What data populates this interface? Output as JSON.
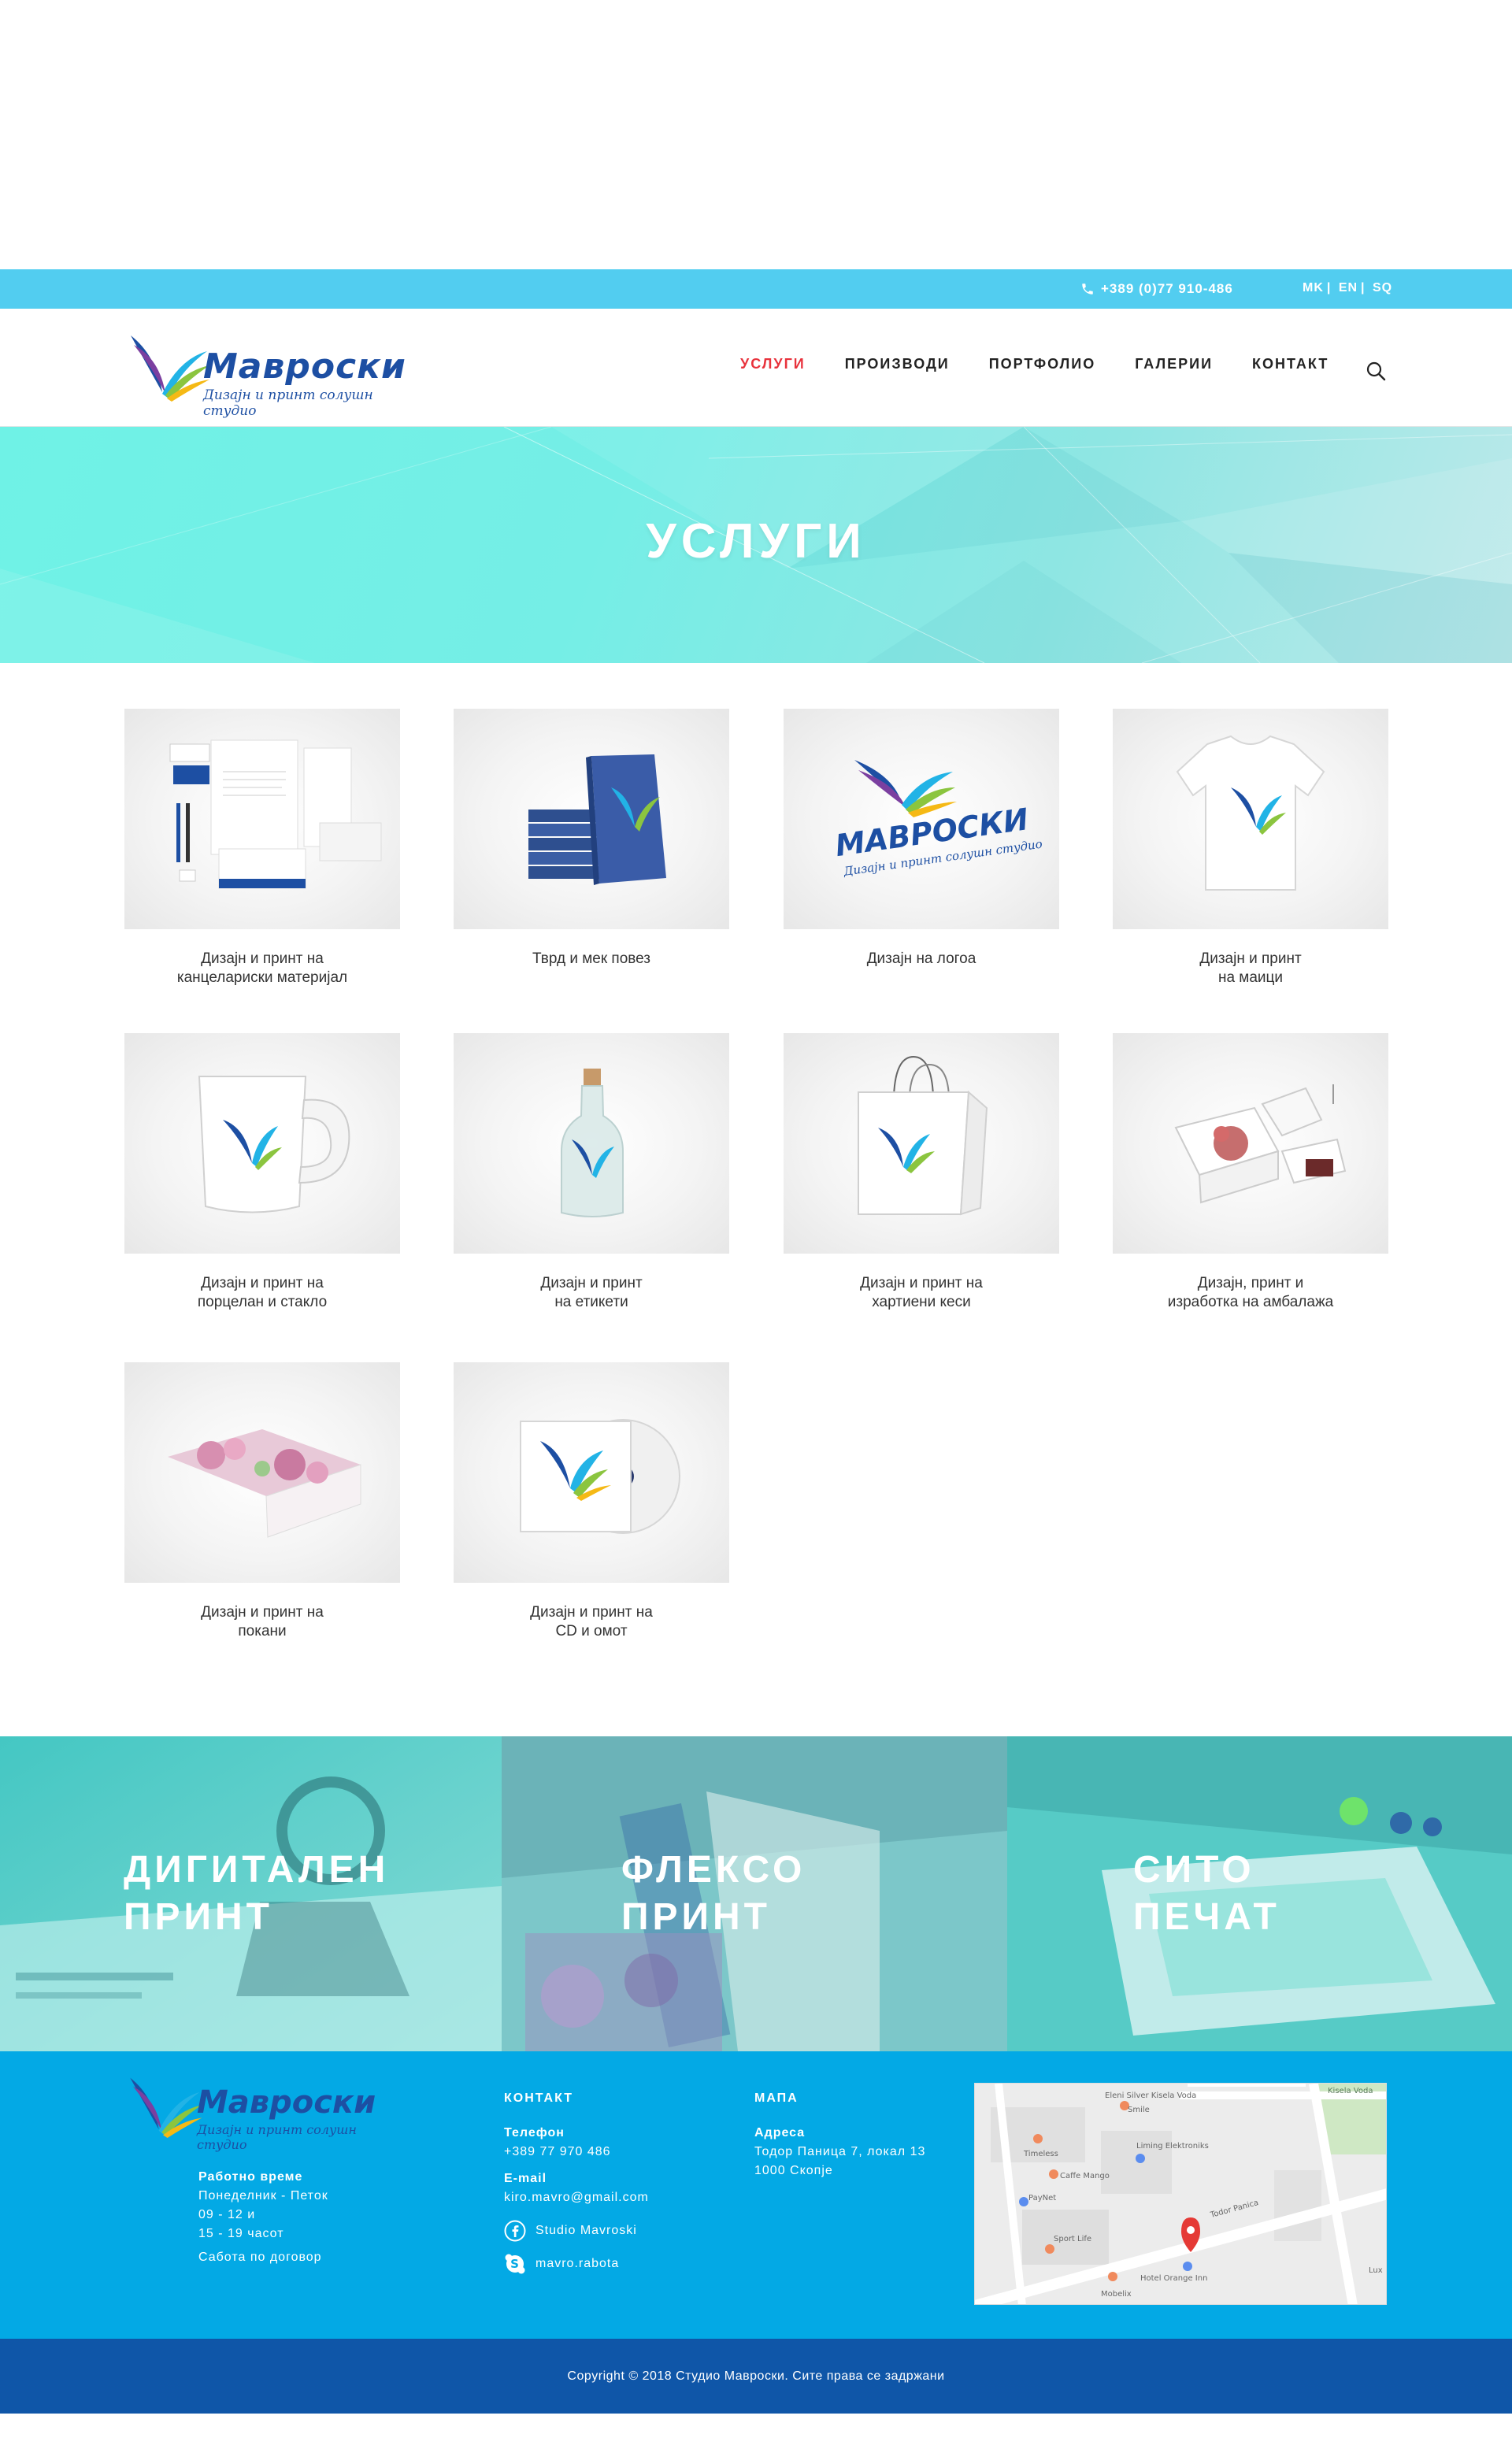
{
  "topbar": {
    "phone": "+389 (0)77 910-486",
    "languages": [
      "MK",
      "EN",
      "SQ"
    ]
  },
  "header": {
    "logo_text": "Мавроски",
    "logo_tagline": "Дизајн и принт солушн студио",
    "nav": [
      "УСЛУГИ",
      "ПРОИЗВОДИ",
      "ПОРТФОЛИО",
      "ГАЛЕРИИ",
      "КОНТАКТ"
    ],
    "active_nav": "УСЛУГИ"
  },
  "hero": {
    "title": "УСЛУГИ"
  },
  "services": [
    {
      "caption": "Дизајн и принт на\nканцелариски материјал",
      "icon": "stationery-icon"
    },
    {
      "caption": "Тврд и мек повез",
      "icon": "book-icon"
    },
    {
      "caption": "Дизајн на логоа",
      "icon": "logo-icon"
    },
    {
      "caption": "Дизајн и принт\nна маици",
      "icon": "tshirt-icon"
    },
    {
      "caption": "Дизајн и принт на\nпорцелан и стакло",
      "icon": "mug-icon"
    },
    {
      "caption": "Дизајн и принт\nна етикети",
      "icon": "bottle-icon"
    },
    {
      "caption": "Дизајн и принт на\nхартиени кеси",
      "icon": "bag-icon"
    },
    {
      "caption": "Дизајн, принт и\nизработка на амбалажа",
      "icon": "packaging-icon"
    },
    {
      "caption": "Дизајн и принт на\nпокани",
      "icon": "invitation-icon"
    },
    {
      "caption": "Дизајн и принт на\nCD и омот",
      "icon": "cd-icon"
    }
  ],
  "print_tiles": [
    {
      "title": "ДИГИТАЛЕН\nПРИНТ"
    },
    {
      "title": "ФЛЕКСО\nПРИНТ"
    },
    {
      "title": "СИТО\nПЕЧАТ"
    }
  ],
  "footer": {
    "logo_text": "Мавроски",
    "logo_tagline": "Дизајн и принт солушн студио",
    "hours_heading": "Работно време",
    "hours_lines": [
      "Понеделник - Петок",
      "09 - 12 и",
      "15 - 19 часот",
      "Сабота по договор"
    ],
    "contact_heading": "КОНТАКТ",
    "phone_label": "Телефон",
    "phone_value": "+389 77 970 486",
    "email_label": "E-mail",
    "email_value": "kiro.mavro@gmail.com",
    "facebook": "Studio Mavroski",
    "skype": "mavro.rabota",
    "map_heading": "МАПА",
    "address_label": "Адреса",
    "address_line1": "Тодор Паница 7, локал 13",
    "address_line2": "1000 Скопје",
    "map_labels": [
      "Kisela Voda",
      "Eleni Silver Kisela Voda",
      "Smile",
      "Timeless",
      "Liming Elektroniks",
      "Caffe Mango",
      "PayNet",
      "Sport Life",
      "Todor Panica",
      "Hotel Orange Inn",
      "Mobelix",
      "Lux"
    ]
  },
  "copyright": "Copyright © 2018 Студио Мавроски. Сите права се задржани",
  "colors": {
    "topbar": "#52cdf0",
    "nav_active": "#e8323c",
    "footer": "#03a9e5",
    "copyright_bar": "#0f56a8",
    "brand_blue": "#1d4fa3"
  }
}
